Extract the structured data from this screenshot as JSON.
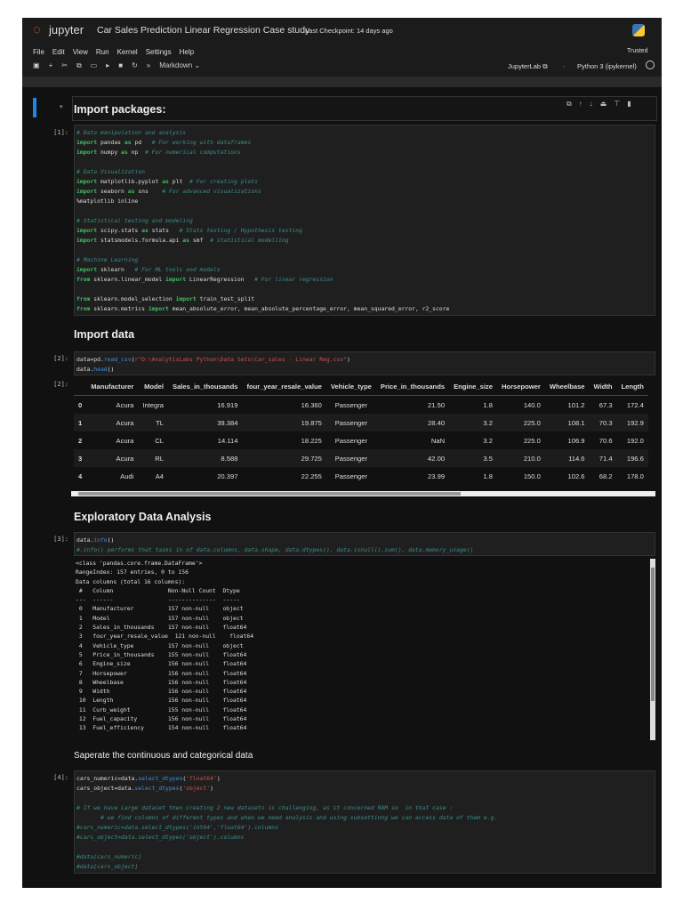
{
  "header": {
    "logo": "jupyter",
    "title": "Car Sales Prediction Linear Regression Case study",
    "checkpoint": "Last Checkpoint: 14 days ago",
    "trusted": "Trusted",
    "jupyterlab": "JupyterLab",
    "kernel": "Python 3 (ipykernel)",
    "cell_type": "Markdown"
  },
  "menu": [
    "File",
    "Edit",
    "View",
    "Run",
    "Kernel",
    "Settings",
    "Help"
  ],
  "headings": {
    "h1": "Import packages:",
    "h2": "Import data",
    "h3": "Exploratory Data Analysis",
    "h4": "Saperate the continuous and categorical data"
  },
  "prompts": {
    "p1": "[1]:",
    "p2": "[2]:",
    "p2out": "[2]:",
    "p3": "[3]:",
    "p4": "[4]:"
  },
  "cell1": [
    "# Data manipulation and analysis",
    "import pandas as pd   # For working with dataframes",
    "import numpy as np  # For numerical computations",
    "",
    "# Data Visualization",
    "import matplotlib.pyplot as plt  # For creating plots",
    "import seaborn as sns    # For advanced visualizations",
    "%matplotlib inline",
    "",
    "# Statistical testing and modeling",
    "import scipy.stats as stats   # Stats testing / Hypothesis testing",
    "import statsmodels.formula.api as smf  # statistical modelling",
    "",
    "# Machine Learning",
    "import sklearn   # For ML tools and models",
    "from sklearn.linear_model import LinearRegression   # For linear regression",
    "",
    "from sklearn.model_selection import train_test_split",
    "from sklearn.metrics import mean_absolute_error, mean_absolute_percentage_error, mean_squared_error, r2_score"
  ],
  "cell2": [
    "data=pd.read_csv(r\"D:\\AnalytixLabs Python\\Data Sets\\Car_sales - Linear Reg.csv\")",
    "data.head()"
  ],
  "table": {
    "columns": [
      "",
      "Manufacturer",
      "Model",
      "Sales_in_thousands",
      "four_year_resale_value",
      "Vehicle_type",
      "Price_in_thousands",
      "Engine_size",
      "Horsepower",
      "Wheelbase",
      "Width",
      "Length"
    ],
    "rows": [
      [
        "0",
        "Acura",
        "Integra",
        "16.919",
        "16.360",
        "Passenger",
        "21.50",
        "1.8",
        "140.0",
        "101.2",
        "67.3",
        "172.4"
      ],
      [
        "1",
        "Acura",
        "TL",
        "39.384",
        "19.875",
        "Passenger",
        "28.40",
        "3.2",
        "225.0",
        "108.1",
        "70.3",
        "192.9"
      ],
      [
        "2",
        "Acura",
        "CL",
        "14.114",
        "18.225",
        "Passenger",
        "NaN",
        "3.2",
        "225.0",
        "106.9",
        "70.6",
        "192.0"
      ],
      [
        "3",
        "Acura",
        "RL",
        "8.588",
        "29.725",
        "Passenger",
        "42.00",
        "3.5",
        "210.0",
        "114.6",
        "71.4",
        "196.6"
      ],
      [
        "4",
        "Audi",
        "A4",
        "20.397",
        "22.255",
        "Passenger",
        "23.99",
        "1.8",
        "150.0",
        "102.6",
        "68.2",
        "178.0"
      ]
    ]
  },
  "cell3": [
    "data.info()",
    "#.info() performs that tasks in of data.columns, data.shape, data.dtypes(), data.isnull().sum(), data.memory_usage()"
  ],
  "info": [
    "<class 'pandas.core.frame.DataFrame'>",
    "RangeIndex: 157 entries, 0 to 156",
    "Data columns (total 16 columns):",
    " #   Column                Non-Null Count  Dtype  ",
    "---  ------                --------------  -----  ",
    " 0   Manufacturer          157 non-null    object ",
    " 1   Model                 157 non-null    object ",
    " 2   Sales_in_thousands    157 non-null    float64",
    " 3   four_year_resale_value  121 non-null    float64",
    " 4   Vehicle_type          157 non-null    object ",
    " 5   Price_in_thousands    155 non-null    float64",
    " 6   Engine_size           156 non-null    float64",
    " 7   Horsepower            156 non-null    float64",
    " 8   Wheelbase             156 non-null    float64",
    " 9   Width                 156 non-null    float64",
    " 10  Length                156 non-null    float64",
    " 11  Curb_weight           155 non-null    float64",
    " 12  Fuel_capacity         156 non-null    float64",
    " 13  Fuel_efficiency       154 non-null    float64"
  ],
  "cell4": [
    "cars_numeric=data.select_dtypes('float64')",
    "cars_object=data.select_dtypes('object')",
    "",
    "# If we have Large dataset then creating 2 new datasets is challenging, as it concerned RAM so  in that case :",
    "       # we find columns of different types and when we need analysis and using subsettinng we can access data of them e.g.",
    "#cars_numeric=data.select_dtypes('int64','float64').columns",
    "#cars_object=data.select_dtypes('object').columns",
    "",
    "#data[cars_numeric]",
    "#data[cars_object]"
  ]
}
